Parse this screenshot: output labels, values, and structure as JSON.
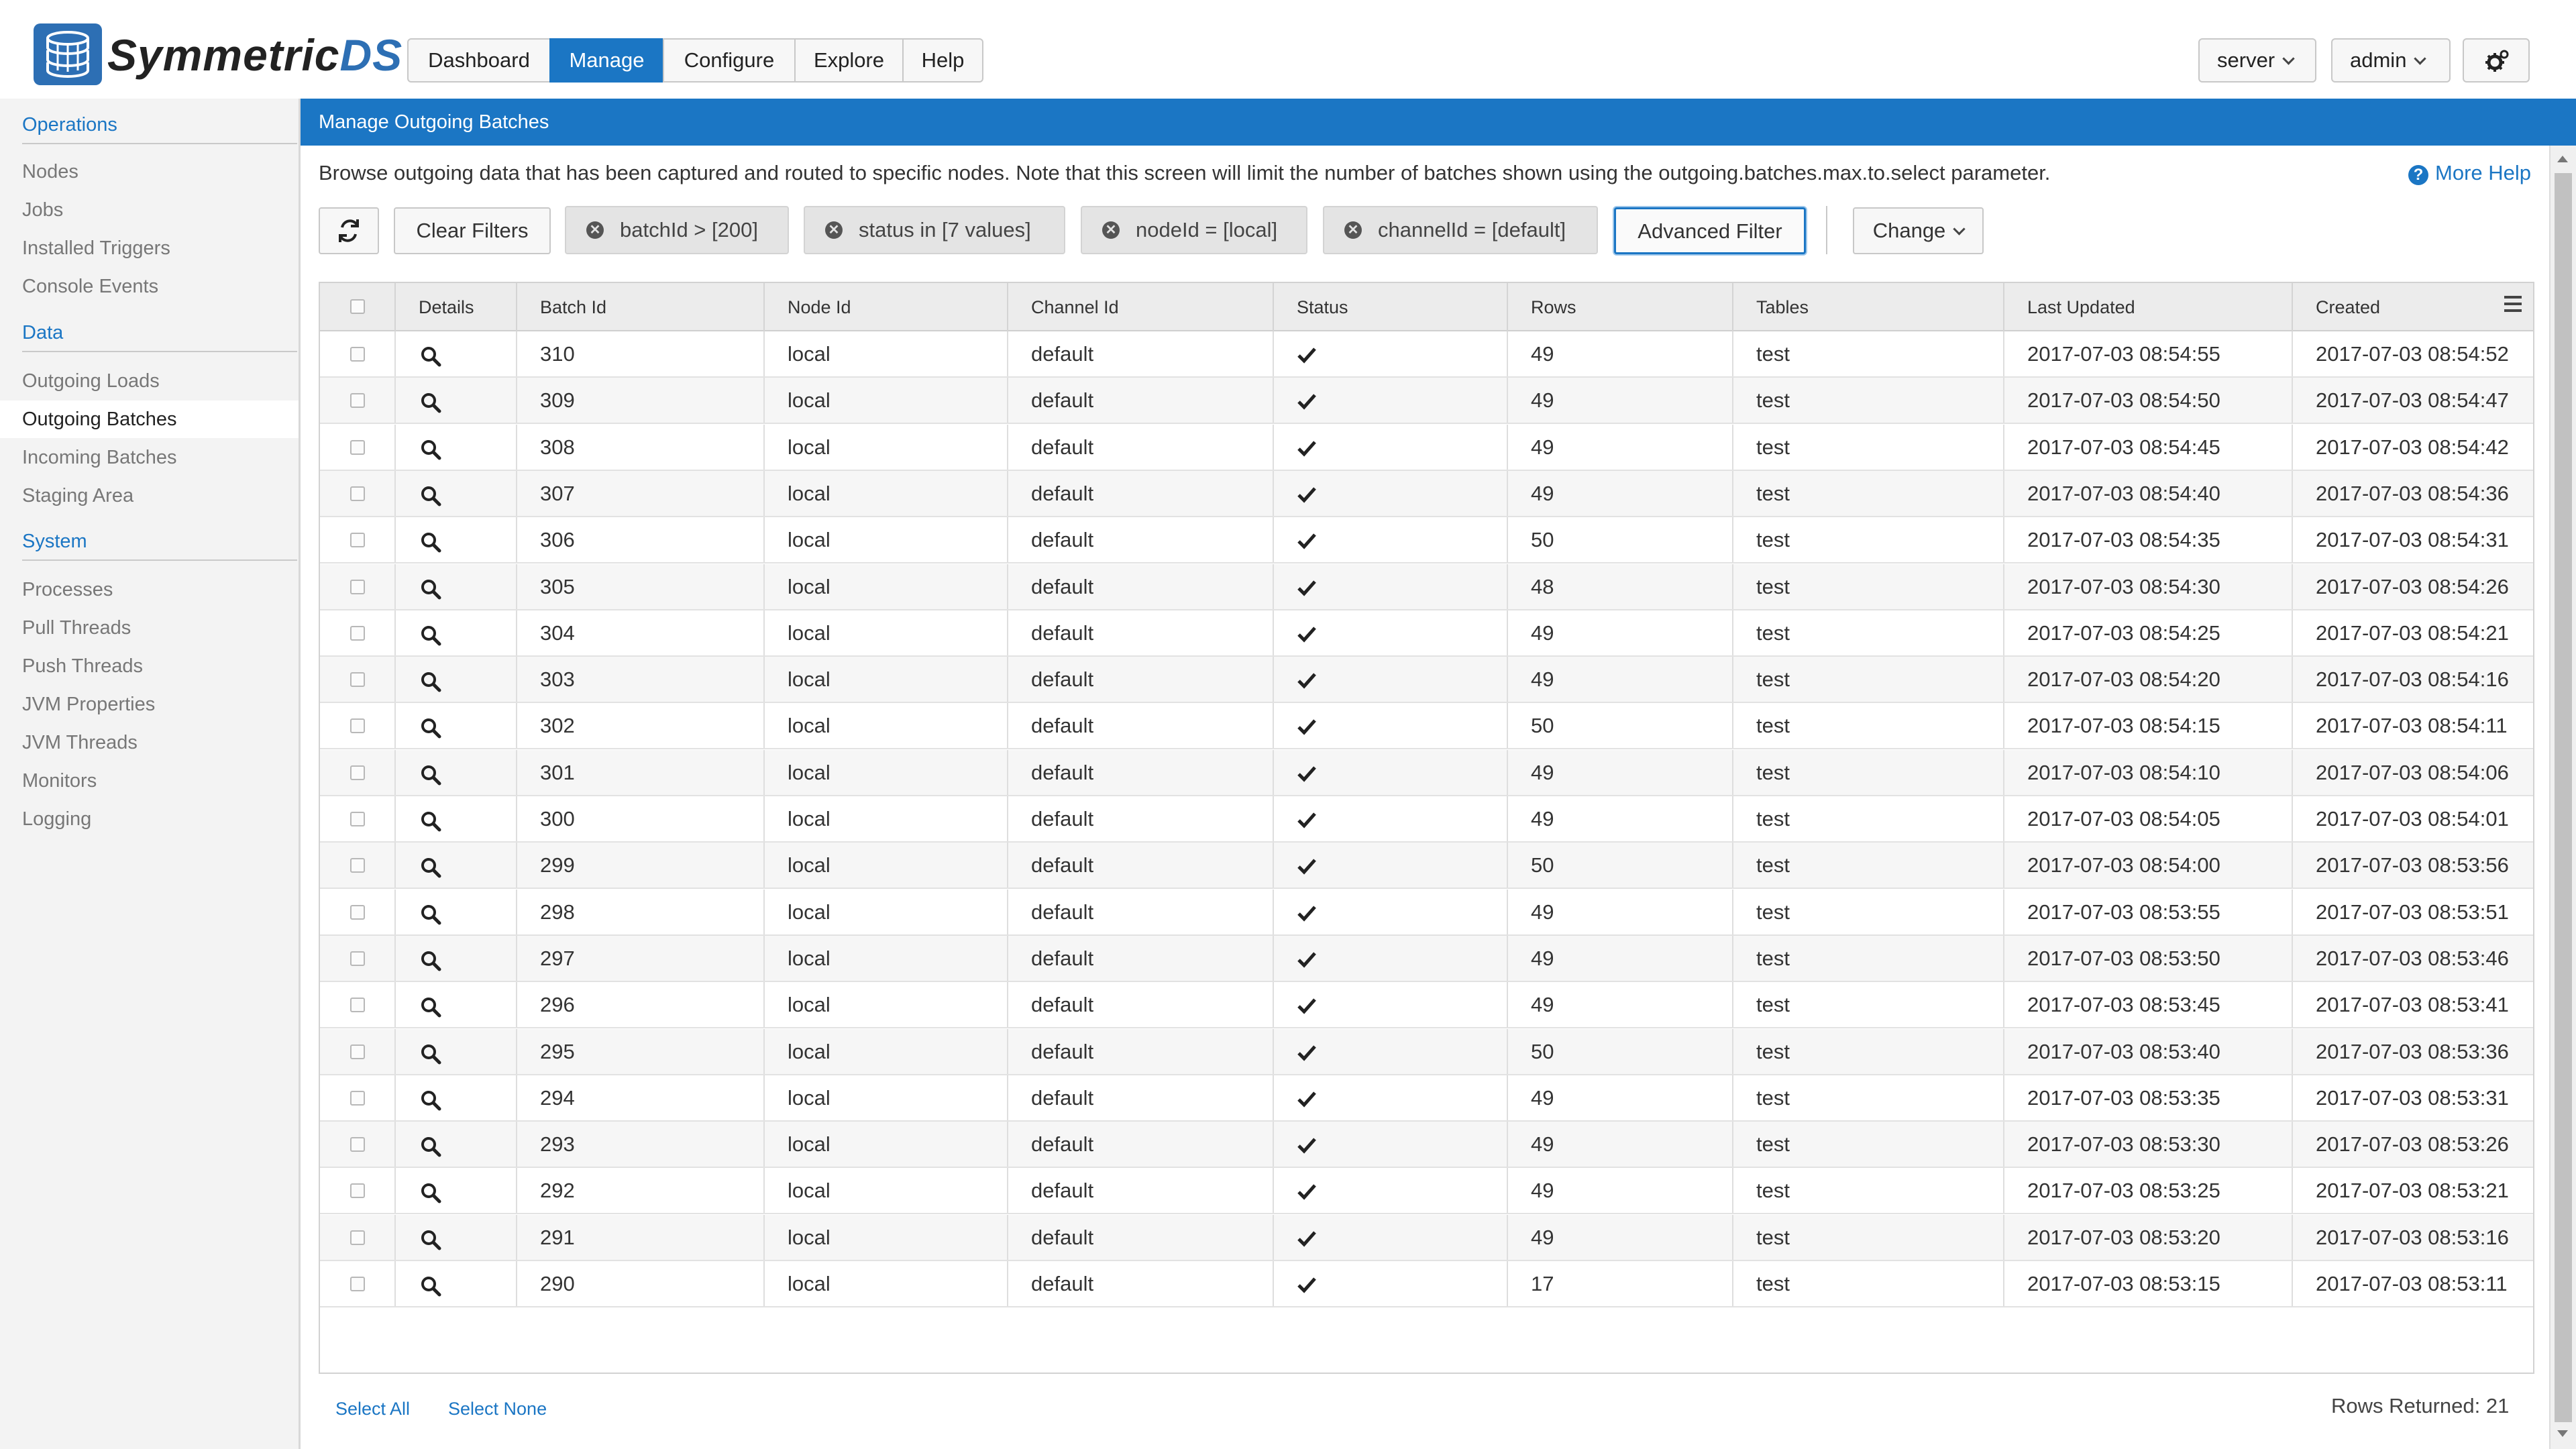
{
  "header": {
    "logo_text_main": "Symmetric",
    "logo_text_ds": "DS",
    "nav": [
      "Dashboard",
      "Manage",
      "Configure",
      "Explore",
      "Help"
    ],
    "active_nav": "Manage",
    "server_label": "server",
    "user_label": "admin",
    "settings_icon": "gears-icon"
  },
  "sidebar": {
    "sections": [
      {
        "title": "Operations",
        "items": [
          "Nodes",
          "Jobs",
          "Installed Triggers",
          "Console Events"
        ]
      },
      {
        "title": "Data",
        "items": [
          "Outgoing Loads",
          "Outgoing Batches",
          "Incoming Batches",
          "Staging Area"
        ]
      },
      {
        "title": "System",
        "items": [
          "Processes",
          "Pull Threads",
          "Push Threads",
          "JVM Properties",
          "JVM Threads",
          "Monitors",
          "Logging"
        ]
      }
    ],
    "active_item": "Outgoing Batches"
  },
  "main": {
    "title": "Manage Outgoing Batches",
    "description": "Browse outgoing data that has been captured and routed to specific nodes. Note that this screen will limit the number of batches shown using the outgoing.batches.max.to.select parameter.",
    "more_help": "More Help",
    "clear_filters": "Clear Filters",
    "filters": [
      "batchId > [200]",
      "status in [7 values]",
      "nodeId = [local]",
      "channelId = [default]"
    ],
    "advanced_filter": "Advanced Filter",
    "change": "Change"
  },
  "table": {
    "columns": [
      "",
      "Details",
      "Batch Id",
      "Node Id",
      "Channel Id",
      "Status",
      "Rows",
      "Tables",
      "Last Updated",
      "Created"
    ],
    "rows": [
      {
        "batch_id": "310",
        "node_id": "local",
        "channel_id": "default",
        "status": "ok",
        "rows": "49",
        "tables": "test",
        "last_updated": "2017-07-03 08:54:55",
        "created": "2017-07-03 08:54:52"
      },
      {
        "batch_id": "309",
        "node_id": "local",
        "channel_id": "default",
        "status": "ok",
        "rows": "49",
        "tables": "test",
        "last_updated": "2017-07-03 08:54:50",
        "created": "2017-07-03 08:54:47"
      },
      {
        "batch_id": "308",
        "node_id": "local",
        "channel_id": "default",
        "status": "ok",
        "rows": "49",
        "tables": "test",
        "last_updated": "2017-07-03 08:54:45",
        "created": "2017-07-03 08:54:42"
      },
      {
        "batch_id": "307",
        "node_id": "local",
        "channel_id": "default",
        "status": "ok",
        "rows": "49",
        "tables": "test",
        "last_updated": "2017-07-03 08:54:40",
        "created": "2017-07-03 08:54:36"
      },
      {
        "batch_id": "306",
        "node_id": "local",
        "channel_id": "default",
        "status": "ok",
        "rows": "50",
        "tables": "test",
        "last_updated": "2017-07-03 08:54:35",
        "created": "2017-07-03 08:54:31"
      },
      {
        "batch_id": "305",
        "node_id": "local",
        "channel_id": "default",
        "status": "ok",
        "rows": "48",
        "tables": "test",
        "last_updated": "2017-07-03 08:54:30",
        "created": "2017-07-03 08:54:26"
      },
      {
        "batch_id": "304",
        "node_id": "local",
        "channel_id": "default",
        "status": "ok",
        "rows": "49",
        "tables": "test",
        "last_updated": "2017-07-03 08:54:25",
        "created": "2017-07-03 08:54:21"
      },
      {
        "batch_id": "303",
        "node_id": "local",
        "channel_id": "default",
        "status": "ok",
        "rows": "49",
        "tables": "test",
        "last_updated": "2017-07-03 08:54:20",
        "created": "2017-07-03 08:54:16"
      },
      {
        "batch_id": "302",
        "node_id": "local",
        "channel_id": "default",
        "status": "ok",
        "rows": "50",
        "tables": "test",
        "last_updated": "2017-07-03 08:54:15",
        "created": "2017-07-03 08:54:11"
      },
      {
        "batch_id": "301",
        "node_id": "local",
        "channel_id": "default",
        "status": "ok",
        "rows": "49",
        "tables": "test",
        "last_updated": "2017-07-03 08:54:10",
        "created": "2017-07-03 08:54:06"
      },
      {
        "batch_id": "300",
        "node_id": "local",
        "channel_id": "default",
        "status": "ok",
        "rows": "49",
        "tables": "test",
        "last_updated": "2017-07-03 08:54:05",
        "created": "2017-07-03 08:54:01"
      },
      {
        "batch_id": "299",
        "node_id": "local",
        "channel_id": "default",
        "status": "ok",
        "rows": "50",
        "tables": "test",
        "last_updated": "2017-07-03 08:54:00",
        "created": "2017-07-03 08:53:56"
      },
      {
        "batch_id": "298",
        "node_id": "local",
        "channel_id": "default",
        "status": "ok",
        "rows": "49",
        "tables": "test",
        "last_updated": "2017-07-03 08:53:55",
        "created": "2017-07-03 08:53:51"
      },
      {
        "batch_id": "297",
        "node_id": "local",
        "channel_id": "default",
        "status": "ok",
        "rows": "49",
        "tables": "test",
        "last_updated": "2017-07-03 08:53:50",
        "created": "2017-07-03 08:53:46"
      },
      {
        "batch_id": "296",
        "node_id": "local",
        "channel_id": "default",
        "status": "ok",
        "rows": "49",
        "tables": "test",
        "last_updated": "2017-07-03 08:53:45",
        "created": "2017-07-03 08:53:41"
      },
      {
        "batch_id": "295",
        "node_id": "local",
        "channel_id": "default",
        "status": "ok",
        "rows": "50",
        "tables": "test",
        "last_updated": "2017-07-03 08:53:40",
        "created": "2017-07-03 08:53:36"
      },
      {
        "batch_id": "294",
        "node_id": "local",
        "channel_id": "default",
        "status": "ok",
        "rows": "49",
        "tables": "test",
        "last_updated": "2017-07-03 08:53:35",
        "created": "2017-07-03 08:53:31"
      },
      {
        "batch_id": "293",
        "node_id": "local",
        "channel_id": "default",
        "status": "ok",
        "rows": "49",
        "tables": "test",
        "last_updated": "2017-07-03 08:53:30",
        "created": "2017-07-03 08:53:26"
      },
      {
        "batch_id": "292",
        "node_id": "local",
        "channel_id": "default",
        "status": "ok",
        "rows": "49",
        "tables": "test",
        "last_updated": "2017-07-03 08:53:25",
        "created": "2017-07-03 08:53:21"
      },
      {
        "batch_id": "291",
        "node_id": "local",
        "channel_id": "default",
        "status": "ok",
        "rows": "49",
        "tables": "test",
        "last_updated": "2017-07-03 08:53:20",
        "created": "2017-07-03 08:53:16"
      },
      {
        "batch_id": "290",
        "node_id": "local",
        "channel_id": "default",
        "status": "ok",
        "rows": "17",
        "tables": "test",
        "last_updated": "2017-07-03 08:53:15",
        "created": "2017-07-03 08:53:11"
      }
    ]
  },
  "footer": {
    "select_all": "Select All",
    "select_none": "Select None",
    "rows_returned": "Rows Returned: 21"
  },
  "colors": {
    "accent": "#1b76c4",
    "sidebar_bg": "#f3f3f3",
    "header_row_bg": "#ececec"
  }
}
